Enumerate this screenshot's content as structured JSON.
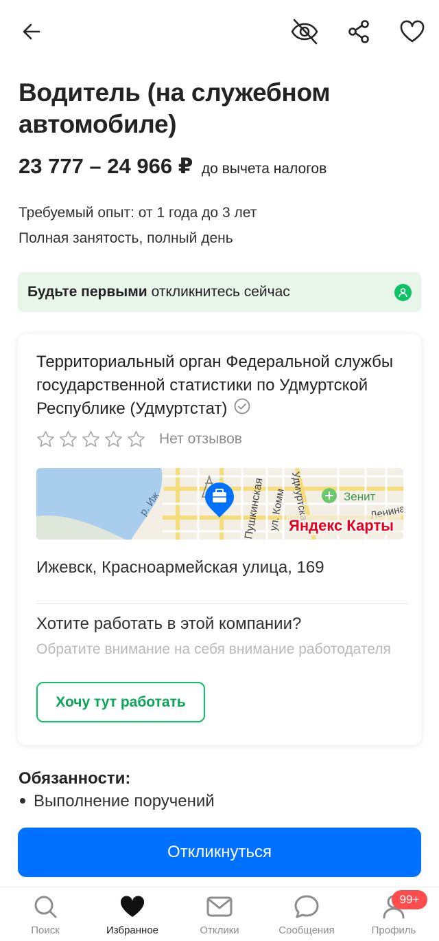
{
  "vacancy": {
    "title": "Водитель (на служебном автомобиле)",
    "salary": "23 777 – 24 966 ₽",
    "salary_note": "до вычета налогов",
    "experience": "Требуемый опыт: от 1 года до 3 лет",
    "employment": "Полная занятость, полный день"
  },
  "banner": {
    "bold": "Будьте первыми",
    "text": "откликнитесь сейчас",
    "icon": "user-icon"
  },
  "company": {
    "name": "Территориальный орган Федеральной службы государственной статистики по Удмуртской Республике (Удмуртстат)",
    "rating_stars": 0,
    "reviews": "Нет отзывов",
    "address": "Ижевск, Красноармейская улица, 169",
    "want_title": "Хотите работать в этой компании?",
    "want_sub": "Обратите внимание на себя внимание работодателя",
    "want_button": "Хочу тут работать"
  },
  "map": {
    "labels": {
      "street1": "Пушкинская",
      "street2": "ул. Комм",
      "street3": "Удмуртская",
      "street4": "Ленина",
      "river": "р. Иж",
      "stadium": "Зенит",
      "brand": "Яндекс Карты"
    }
  },
  "duties": {
    "heading": "Обязанности:",
    "items": [
      "Выполнение поручений"
    ]
  },
  "apply_button": "Откликнуться",
  "tabs": [
    {
      "label": "Поиск",
      "icon": "search-icon"
    },
    {
      "label": "Избранное",
      "icon": "heart-icon"
    },
    {
      "label": "Отклики",
      "icon": "mail-icon"
    },
    {
      "label": "Сообщения",
      "icon": "chat-icon"
    },
    {
      "label": "Профиль",
      "icon": "profile-icon"
    }
  ],
  "active_tab": "Избранное",
  "profile_counter": "99+",
  "colors": {
    "accent_blue": "#0070ff",
    "accent_green": "#0dc267",
    "banner_bg": "#e8f6ea",
    "badge_red": "#ff4d4d"
  }
}
